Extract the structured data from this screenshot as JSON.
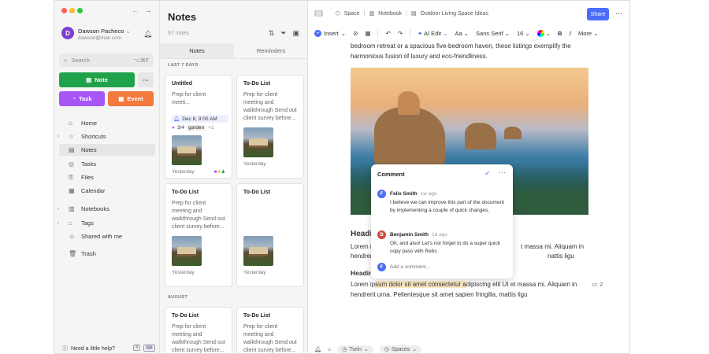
{
  "sidebar": {
    "user_name": "Dawson Pacheco",
    "user_email": "dawson@mail.com",
    "avatar_letter": "D",
    "search_placeholder": "Search",
    "search_shortcut": "⌥⌘F",
    "note_button": "Note",
    "task_button": "Task",
    "event_button": "Event",
    "nav": [
      "Home",
      "Shortcuts",
      "Notes",
      "Tasks",
      "Files",
      "Calendar",
      "Notebooks",
      "Tags",
      "Shared with me",
      "Trash"
    ],
    "help": "Need a little help?"
  },
  "notes": {
    "title": "Notes",
    "count": "97 notes",
    "tabs": [
      "Notes",
      "Reminders"
    ],
    "section_recent": "LAST 7 DAYS",
    "section_august": "AUGUST",
    "cards": [
      {
        "title": "Untitled",
        "desc": "Prep for client meeti...",
        "date": "Dec 8, 9:00 AM",
        "tasks": "3/4",
        "tag": "garden",
        "more": "+1",
        "footer": "Yesterday"
      },
      {
        "title": "To-Do List",
        "desc": "Prep for client meeting and walkthrough Send out client survey before...",
        "footer": "Yesterday"
      },
      {
        "title": "To-Do List",
        "desc": "Prep for client meeting and walkthrough Send out client survey before...",
        "footer": "Yesterday"
      },
      {
        "title": "To-Do List",
        "desc": "",
        "footer": "Yesterday"
      },
      {
        "title": "To-Do List",
        "desc": "Prep for client meeting and walkthrough Send out client survey before...",
        "footer": ""
      },
      {
        "title": "To-Do List",
        "desc": "Prep for client meeting and walkthrough Send out client survey before...",
        "footer": ""
      }
    ]
  },
  "editor": {
    "breadcrumb": [
      "Space",
      "Notebook",
      "Outdoor Living Space Ideas"
    ],
    "share": "Share",
    "toolbar": {
      "insert": "Insert",
      "ai": "AI Edit",
      "font": "Sans Serif",
      "size": "16",
      "more": "More"
    },
    "intro": "bedroom retreat or a spacious five-bedroom haven, these listings exemplify the harmonious fusion of luxury and eco-friendliness.",
    "heading1": "Headi",
    "para1a": "Lorem i",
    "para1b": "t massa mi. Aliquam in",
    "para2a": "hendrer",
    "para2b": "nattis ligu",
    "heading2": "Headin",
    "para3_pre": "Lorem ip",
    "para3_hl": "sum dolor sit amet consectetur a",
    "para3_post": "dipiscing elit Ut et massa mi. Aliquam in",
    "para4": "hendrerit urna. Pellentesque sit amet sapien fringilla, mattis ligu",
    "comment_count": "2",
    "bottom": [
      "Turin",
      "Spaces"
    ]
  },
  "comment": {
    "title": "Comment",
    "items": [
      {
        "initial": "F",
        "name": "Felix Smith",
        "time": "1w ago",
        "text": "I believe we can improve this part of the document by implementing a couple of quick changes."
      },
      {
        "initial": "B",
        "name": "Benjamin Smith",
        "time": "1d ago",
        "text": "Oh, and also! Let's not forget to do a super quick copy pass with Rebs"
      }
    ],
    "input_initial": "F",
    "placeholder": "Add a comment..."
  }
}
